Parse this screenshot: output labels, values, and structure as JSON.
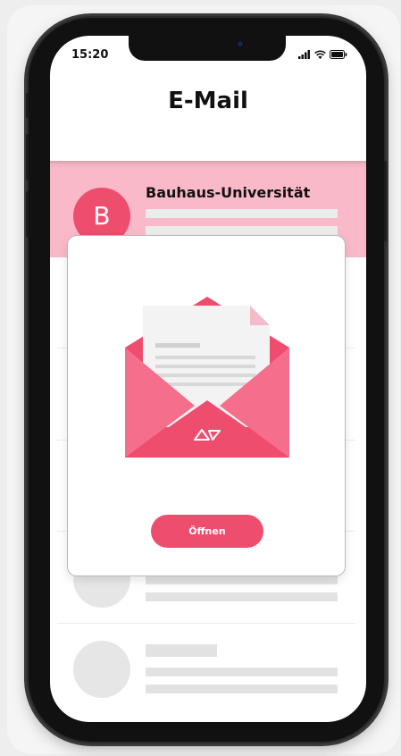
{
  "status_bar": {
    "time": "15:20"
  },
  "header": {
    "title": "E-Mail"
  },
  "inbox": {
    "highlighted_item": {
      "avatar_letter": "B",
      "sender": "Bauhaus-Universität"
    }
  },
  "modal": {
    "illustration": "envelope-icon",
    "open_button_label": "Öffnen"
  },
  "colors": {
    "accent": "#ef4d6e",
    "highlight_row": "#f9b9c8",
    "placeholder": "#e2e2e2"
  }
}
